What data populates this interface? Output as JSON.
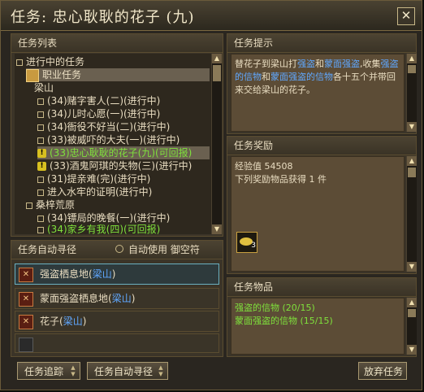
{
  "window": {
    "title": "任务: 忠心耿耿的花子 (九)",
    "close_glyph": "✕"
  },
  "quest_list": {
    "header": "任务列表",
    "root_label": "进行中的任务",
    "category_1": "职业任务",
    "subcategory": "梁山",
    "items": [
      {
        "label": "(34)赌字害人(二)(进行中)",
        "marker": "square",
        "green": false
      },
      {
        "label": "(34)儿时心愿(一)(进行中)",
        "marker": "square",
        "green": false
      },
      {
        "label": "(34)衙役不好当(二)(进行中)",
        "marker": "square",
        "green": false
      },
      {
        "label": "(33)被威吓的大夫(一)(进行中)",
        "marker": "square",
        "green": false
      },
      {
        "label": "(33)忠心耿耿的花子(九)(可回报)",
        "marker": "exclaim",
        "green": true,
        "selected": true
      },
      {
        "label": "(33)酒鬼阿琪的失物(三)(进行中)",
        "marker": "exclaim",
        "green": false
      },
      {
        "label": "(31)提亲难(完)(进行中)",
        "marker": "square",
        "green": false
      },
      {
        "label": "进入水牢的证明(进行中)",
        "marker": "square",
        "green": false
      }
    ],
    "category_2": "桑梓荒原",
    "items_2": [
      {
        "label": "(34)镖局的晚餐(一)(进行中)",
        "marker": "square",
        "green": false
      },
      {
        "label": "(34)家乡有我(四)(可回报)",
        "marker": "square",
        "green": true
      }
    ]
  },
  "auto_path": {
    "header": "任务自动寻径",
    "checkbox_label": "自动使用 御空符",
    "checked": false,
    "rows": [
      {
        "name": "强盗栖息地",
        "place": "梁山"
      },
      {
        "name": "蒙面强盗栖息地",
        "place": "梁山"
      },
      {
        "name": "花子",
        "place": "梁山"
      }
    ],
    "paren_open": "(",
    "paren_close": ")"
  },
  "hint": {
    "header": "任务提示",
    "text_parts": [
      {
        "t": "替花子到梁山打",
        "c": "white"
      },
      {
        "t": "强盗",
        "c": "blue"
      },
      {
        "t": "和",
        "c": "white"
      },
      {
        "t": "蒙面强盗",
        "c": "blue"
      },
      {
        "t": ",收集",
        "c": "white"
      },
      {
        "t": "强盗的信物",
        "c": "blue"
      },
      {
        "t": "和",
        "c": "white"
      },
      {
        "t": "蒙面强盗的信物",
        "c": "blue"
      },
      {
        "t": "各十五个并带回来交给梁山的花子。",
        "c": "white"
      }
    ]
  },
  "reward": {
    "header": "任务奖励",
    "exp_label": "经验值",
    "exp_value": "54508",
    "items_line": "下列奖励物品获得 1 件",
    "item_count": "3"
  },
  "items_needed": {
    "header": "任务物品",
    "list": [
      {
        "label": "强盗的信物 (20/15)"
      },
      {
        "label": "蒙面强盗的信物 (15/15)"
      }
    ]
  },
  "buttons": {
    "track": "任务追踪",
    "auto_path": "任务自动寻径",
    "abandon": "放弃任务"
  },
  "colors": {
    "accent_green": "#7fe03c",
    "link_blue": "#60a8ff",
    "frame_gold": "#c8b888"
  }
}
